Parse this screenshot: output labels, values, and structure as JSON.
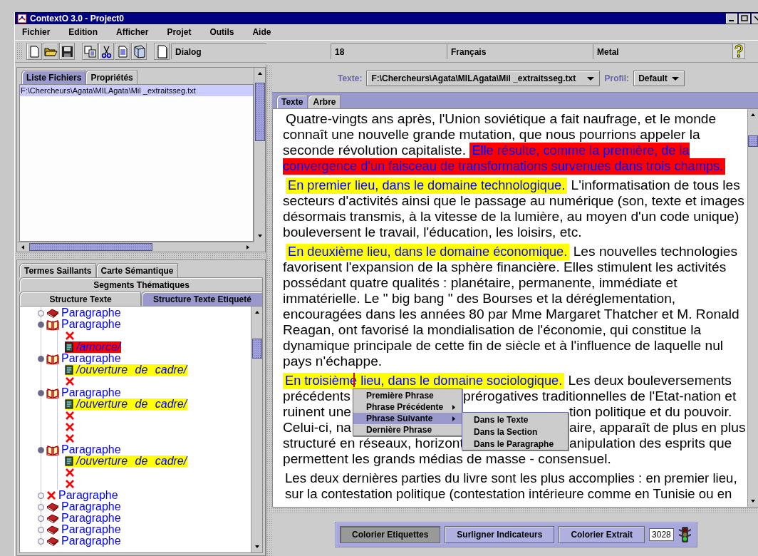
{
  "window": {
    "title": "ContextO 3.0 - Project0"
  },
  "menu_bar": [
    "Fichier",
    "Edition",
    "Afficher",
    "Projet",
    "Outils",
    "Aide"
  ],
  "toolbar": {
    "fields": [
      "Dialog",
      "18",
      "Français",
      "Metal"
    ]
  },
  "files_panel": {
    "tabs": [
      {
        "label": "Liste Fichiers",
        "selected": true
      },
      {
        "label": "Propriétés",
        "selected": false
      }
    ],
    "items": [
      {
        "label": "F:\\Chercheurs\\Agata\\MILAgata\\Mil _extraitsseg.txt",
        "selected": true
      }
    ]
  },
  "structure_panel": {
    "tab_rows": [
      [
        {
          "label": "Termes Saillants",
          "selected": false
        },
        {
          "label": "Carte Sémantique",
          "selected": false
        }
      ],
      [
        {
          "label": "Segments Thématiques",
          "selected": false
        }
      ],
      [
        {
          "label": "Structure Texte",
          "selected": false
        },
        {
          "label": "Structure Texte Etiqueté",
          "selected": true
        }
      ]
    ],
    "tree": [
      {
        "label": "Paragraphe",
        "kind": "paragraph",
        "expanded": false
      },
      {
        "label": "Paragraphe",
        "kind": "paragraph",
        "expanded": true,
        "children": [
          {
            "kind": "empty"
          },
          {
            "kind": "tag",
            "label": "/amorce/",
            "color": "#ff0000"
          }
        ]
      },
      {
        "label": "Paragraphe",
        "kind": "paragraph",
        "expanded": true,
        "children": [
          {
            "kind": "tag",
            "label": "/ouverture de cadre/",
            "color": "#ffff00"
          },
          {
            "kind": "empty"
          }
        ]
      },
      {
        "label": "Paragraphe",
        "kind": "paragraph",
        "expanded": true,
        "children": [
          {
            "kind": "tag",
            "label": "/ouverture de cadre/",
            "color": "#ffff00"
          },
          {
            "kind": "empty"
          },
          {
            "kind": "empty"
          },
          {
            "kind": "empty"
          }
        ]
      },
      {
        "label": "Paragraphe",
        "kind": "paragraph",
        "expanded": true,
        "children": [
          {
            "kind": "tag",
            "label": "/ouverture de cadre/",
            "color": "#ffff00"
          },
          {
            "kind": "empty"
          },
          {
            "kind": "empty"
          }
        ]
      },
      {
        "label": "Paragraphe",
        "kind": "empty",
        "expanded": false
      },
      {
        "label": "Paragraphe",
        "kind": "paragraph",
        "expanded": false
      },
      {
        "label": "Paragraphe",
        "kind": "paragraph",
        "expanded": false
      },
      {
        "label": "Paragraphe",
        "kind": "paragraph",
        "expanded": false
      },
      {
        "label": "Paragraphe",
        "kind": "paragraph",
        "expanded": false
      }
    ]
  },
  "text_header": {
    "text_label": "Texte:",
    "text_value": "F:\\Chercheurs\\Agata\\MILAgata\\Mil _extraitsseg.txt",
    "profile_label": "Profil:",
    "profile_value": "Default"
  },
  "view_tabs": [
    {
      "label": "Texte",
      "selected": true
    },
    {
      "label": "Arbre",
      "selected": false
    }
  ],
  "document": {
    "paragraphs": [
      {
        "kind": "flow",
        "segments": [
          {
            "text": "Quatre-vingts ans après, l'Union soviétique a fait naufrage, et le monde connaît une nouvelle grande mutation, que nous pourrions appeler la seconde révolution capitaliste."
          },
          {
            "text": "Elle résulte, comme la première, de la convergence d'un faisceau de transformations survenues dans trois champs.",
            "color": "#ff0000"
          }
        ]
      },
      {
        "kind": "flow",
        "segments": [
          {
            "text": "En premier lieu, dans le domaine technologique.",
            "color": "#ffff00"
          },
          {
            "text": "L'informatisation de tous les secteurs d'activités ainsi que le passage au numérique (son, texte et images désormais transmis, à la vitesse de la lumière, au moyen d'un code unique) bouleversent le travail, l'éducation, les loisirs, etc."
          }
        ]
      },
      {
        "kind": "flow",
        "segments": [
          {
            "text": "En deuxième lieu, dans le domaine économique.",
            "color": "#ffff00"
          },
          {
            "text": "Les nouvelles technologies favorisent l'expansion de la sphère financière. Elles stimulent les activités possédant quatre qualités : planétaire, permanente, immédiate et immatérielle. Le \" big bang \" des Bourses et la déréglementation, encouragées dans les années 80 par Mme Margaret Thatcher et M. Ronald Reagan, ont favorisé la mondialisation de l'économie, qui constitue la dynamique principale de cette fin de siècle et à l'influence de laquelle nul pays n'échappe."
          }
        ]
      },
      {
        "kind": "covered",
        "lines": [
          {
            "segments": [
              {
                "text": "En troisième lieu, dans le domaine sociologique.",
                "color": "#ffff00"
              },
              {
                "text": "Les deux bouleversements"
              }
            ]
          },
          {
            "left": "précédents",
            "right": "prérogatives traditionnelles de l'Etat-nation et"
          },
          {
            "left": "ruinent une",
            "right": "tion politique et du pouvoir."
          },
          {
            "left": "Celui-ci, na",
            "right": "aire, apparaît de plus en plus"
          },
          {
            "left": "structuré en réseaux, horizont",
            "right": "anipulation des esprits que"
          },
          {
            "segments": [
              {
                "text": "permettent les grands médias de masse - consensuel."
              }
            ]
          }
        ]
      },
      {
        "kind": "lines",
        "lines": [
          "Les deux dernières parties du livre sont les plus accomplies : en premier lieu,",
          "sur la contestation politique (contestation intérieure comme en Tunisie ou en"
        ]
      }
    ]
  },
  "context_menu": {
    "items": [
      {
        "label": "Première Phrase",
        "has_submenu": false,
        "selected": false
      },
      {
        "label": "Phrase Précédente",
        "has_submenu": true,
        "selected": false
      },
      {
        "label": "Phrase Suivante",
        "has_submenu": true,
        "selected": true
      },
      {
        "label": "Dernière Phrase",
        "has_submenu": false,
        "selected": false
      }
    ],
    "submenu": [
      {
        "label": "Dans le Texte",
        "selected": false
      },
      {
        "label": "Dans la Section",
        "selected": false
      },
      {
        "label": "Dans le Paragraphe",
        "selected": false
      }
    ]
  },
  "actions": {
    "buttons": [
      {
        "label": "Colorier Etiquettes",
        "selected": true
      },
      {
        "label": "Surligner Indicateurs",
        "selected": false
      },
      {
        "label": "Colorier Extrait",
        "selected": false
      }
    ],
    "counter": "3028"
  }
}
